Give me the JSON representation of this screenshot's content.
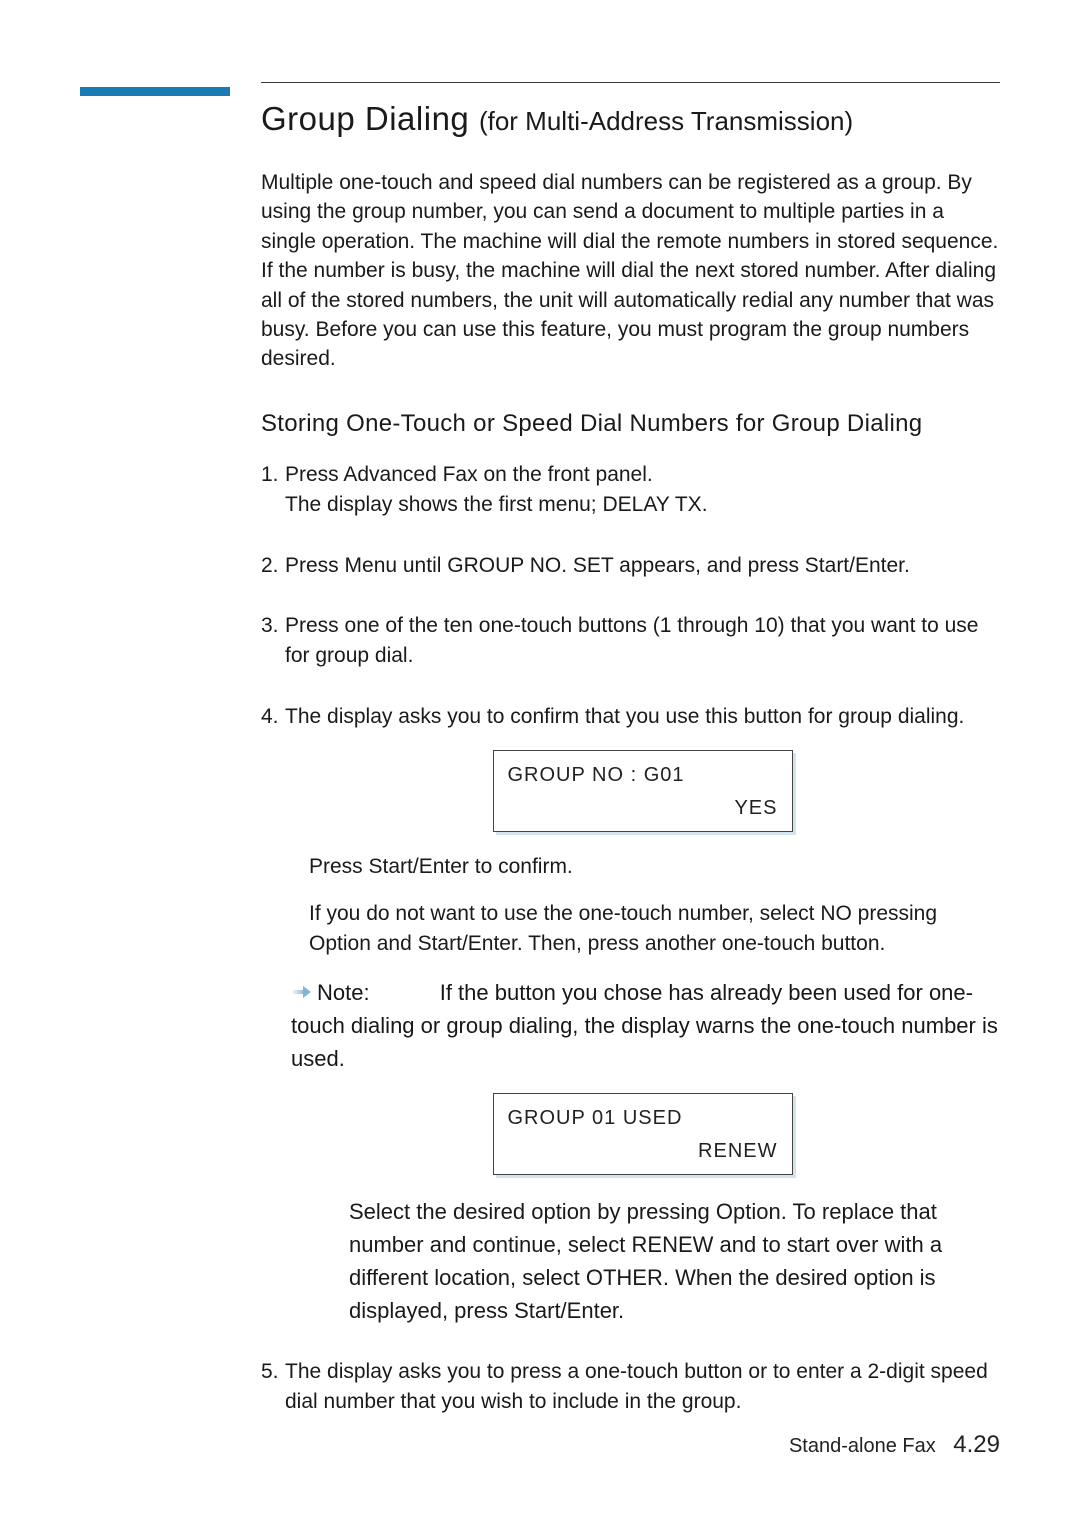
{
  "title_main": "Group Dialing ",
  "title_sub": "(for Multi-Address Transmission)",
  "intro": "Multiple one-touch and speed dial numbers can be registered as a group. By using the group number, you can send a document to multiple parties in a single operation. The machine will dial the remote numbers in stored sequence. If the number is busy, the machine will dial the next stored number. After dialing all of the stored numbers, the unit will automatically redial any number that was busy. Before you can use this feature, you must program the group numbers desired.",
  "section": "Storing One-Touch or Speed Dial Numbers for Group Dialing",
  "steps": {
    "s1_num": "1.",
    "s1_a": "Press ",
    "s1_b": "Advanced Fax",
    "s1_c": " on the front panel.",
    "s1_d": "The display shows the first menu; DELAY TX.",
    "s2_num": "2.",
    "s2_a": "Press ",
    "s2_b": "Menu",
    "s2_c": " until ",
    "s2_d": "GROUP NO. SET",
    "s2_e": " appears, and press ",
    "s2_f": "Start/Enter",
    "s2_g": ".",
    "s3_num": "3.",
    "s3": "Press one of the ten one-touch buttons (1 through 10) that you want to use for group dial.",
    "s4_num": "4.",
    "s4": "The display asks you to confirm that you use this button for group dialing.",
    "s5_num": "5.",
    "s5": "The display asks you to press a one-touch button or to enter a 2-digit speed dial number that you wish to include in the group."
  },
  "lcd1": {
    "line1": "GROUP  NO : G01",
    "line2": "YES"
  },
  "after_lcd1": {
    "p1_a": "Press ",
    "p1_b": "Start/Enter",
    "p1_c": " to confirm.",
    "p2_a": "If you do not want to use the one-touch number, select ",
    "p2_b": "NO",
    "p2_c": " pressing ",
    "p2_d": "Option",
    "p2_e": " and ",
    "p2_f": "Start/Enter",
    "p2_g": ". Then, press another one-touch button."
  },
  "note": {
    "label": "Note:",
    "text": "If the button you chose has already been used for one-touch dialing or group dialing, the display warns the one-touch number is used."
  },
  "lcd2": {
    "line1": "GROUP  01 USED",
    "line2": "RENEW"
  },
  "note_para": {
    "a": "Select the desired option by pressing ",
    "b": "Option",
    "c": ". To replace that number and continue, select ",
    "d": "RENEW",
    "e": " and to start over with a different location, select ",
    "f": "OTHER",
    "g": ". When the desired option is displayed, press ",
    "h": "Start/Enter",
    "i": "."
  },
  "footer": {
    "label": "Stand-alone Fax",
    "page": "4.29"
  }
}
